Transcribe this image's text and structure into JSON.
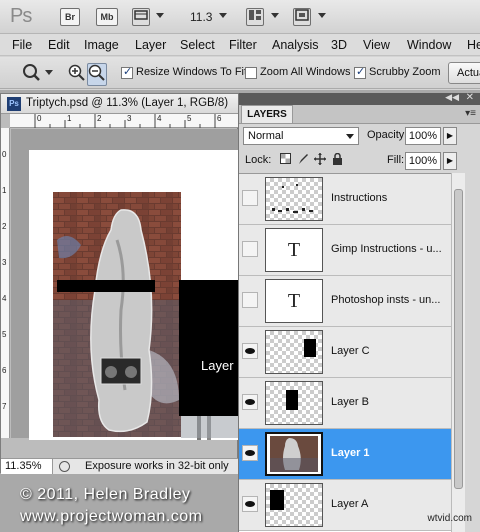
{
  "appbar": {
    "logo": "Ps",
    "br_label": "Br",
    "mb_label": "Mb",
    "zoom_value": "11.3"
  },
  "menu": [
    "File",
    "Edit",
    "Image",
    "Layer",
    "Select",
    "Filter",
    "Analysis",
    "3D",
    "View",
    "Window",
    "He"
  ],
  "options": {
    "resize_windows": {
      "label": "Resize Windows To Fit",
      "checked": true
    },
    "zoom_all": {
      "label": "Zoom All Windows",
      "checked": false
    },
    "scrubby": {
      "label": "Scrubby Zoom",
      "checked": true
    },
    "actual_button": "Actua"
  },
  "document": {
    "title": "Triptych.psd @ 11.3% (Layer 1, RGB/8)",
    "ruler_top": [
      "0",
      "1",
      "2",
      "3",
      "4",
      "5",
      "6"
    ],
    "ruler_left": [
      "0",
      "1",
      "2",
      "3",
      "4",
      "5",
      "6",
      "7"
    ],
    "visible_text": "Layer I",
    "zoom_pct": "11.35%",
    "status_msg": "Exposure works in 32-bit only"
  },
  "layers_panel": {
    "tab_label": "LAYERS",
    "blend_mode": "Normal",
    "opacity_label": "Opacity:",
    "opacity_value": "100%",
    "lock_label": "Lock:",
    "fill_label": "Fill:",
    "fill_value": "100%",
    "layers": [
      {
        "name": "Instructions",
        "visible": false,
        "selected": false,
        "thumb": "dots"
      },
      {
        "name": "Gimp Instructions - u...",
        "visible": false,
        "selected": false,
        "thumb": "text"
      },
      {
        "name": "Photoshop insts - un...",
        "visible": false,
        "selected": false,
        "thumb": "text"
      },
      {
        "name": "Layer C",
        "visible": true,
        "selected": false,
        "thumb": "block-c"
      },
      {
        "name": "Layer B",
        "visible": true,
        "selected": false,
        "thumb": "block-b"
      },
      {
        "name": "Layer 1",
        "visible": true,
        "selected": true,
        "thumb": "photo"
      },
      {
        "name": "Layer A",
        "visible": true,
        "selected": false,
        "thumb": "block-a"
      }
    ],
    "text_thumb_glyph": "T"
  },
  "watermark": {
    "line1": "© 2011, Helen Bradley",
    "line2": "www.projectwoman.com"
  },
  "site_label": "wtvid.com"
}
